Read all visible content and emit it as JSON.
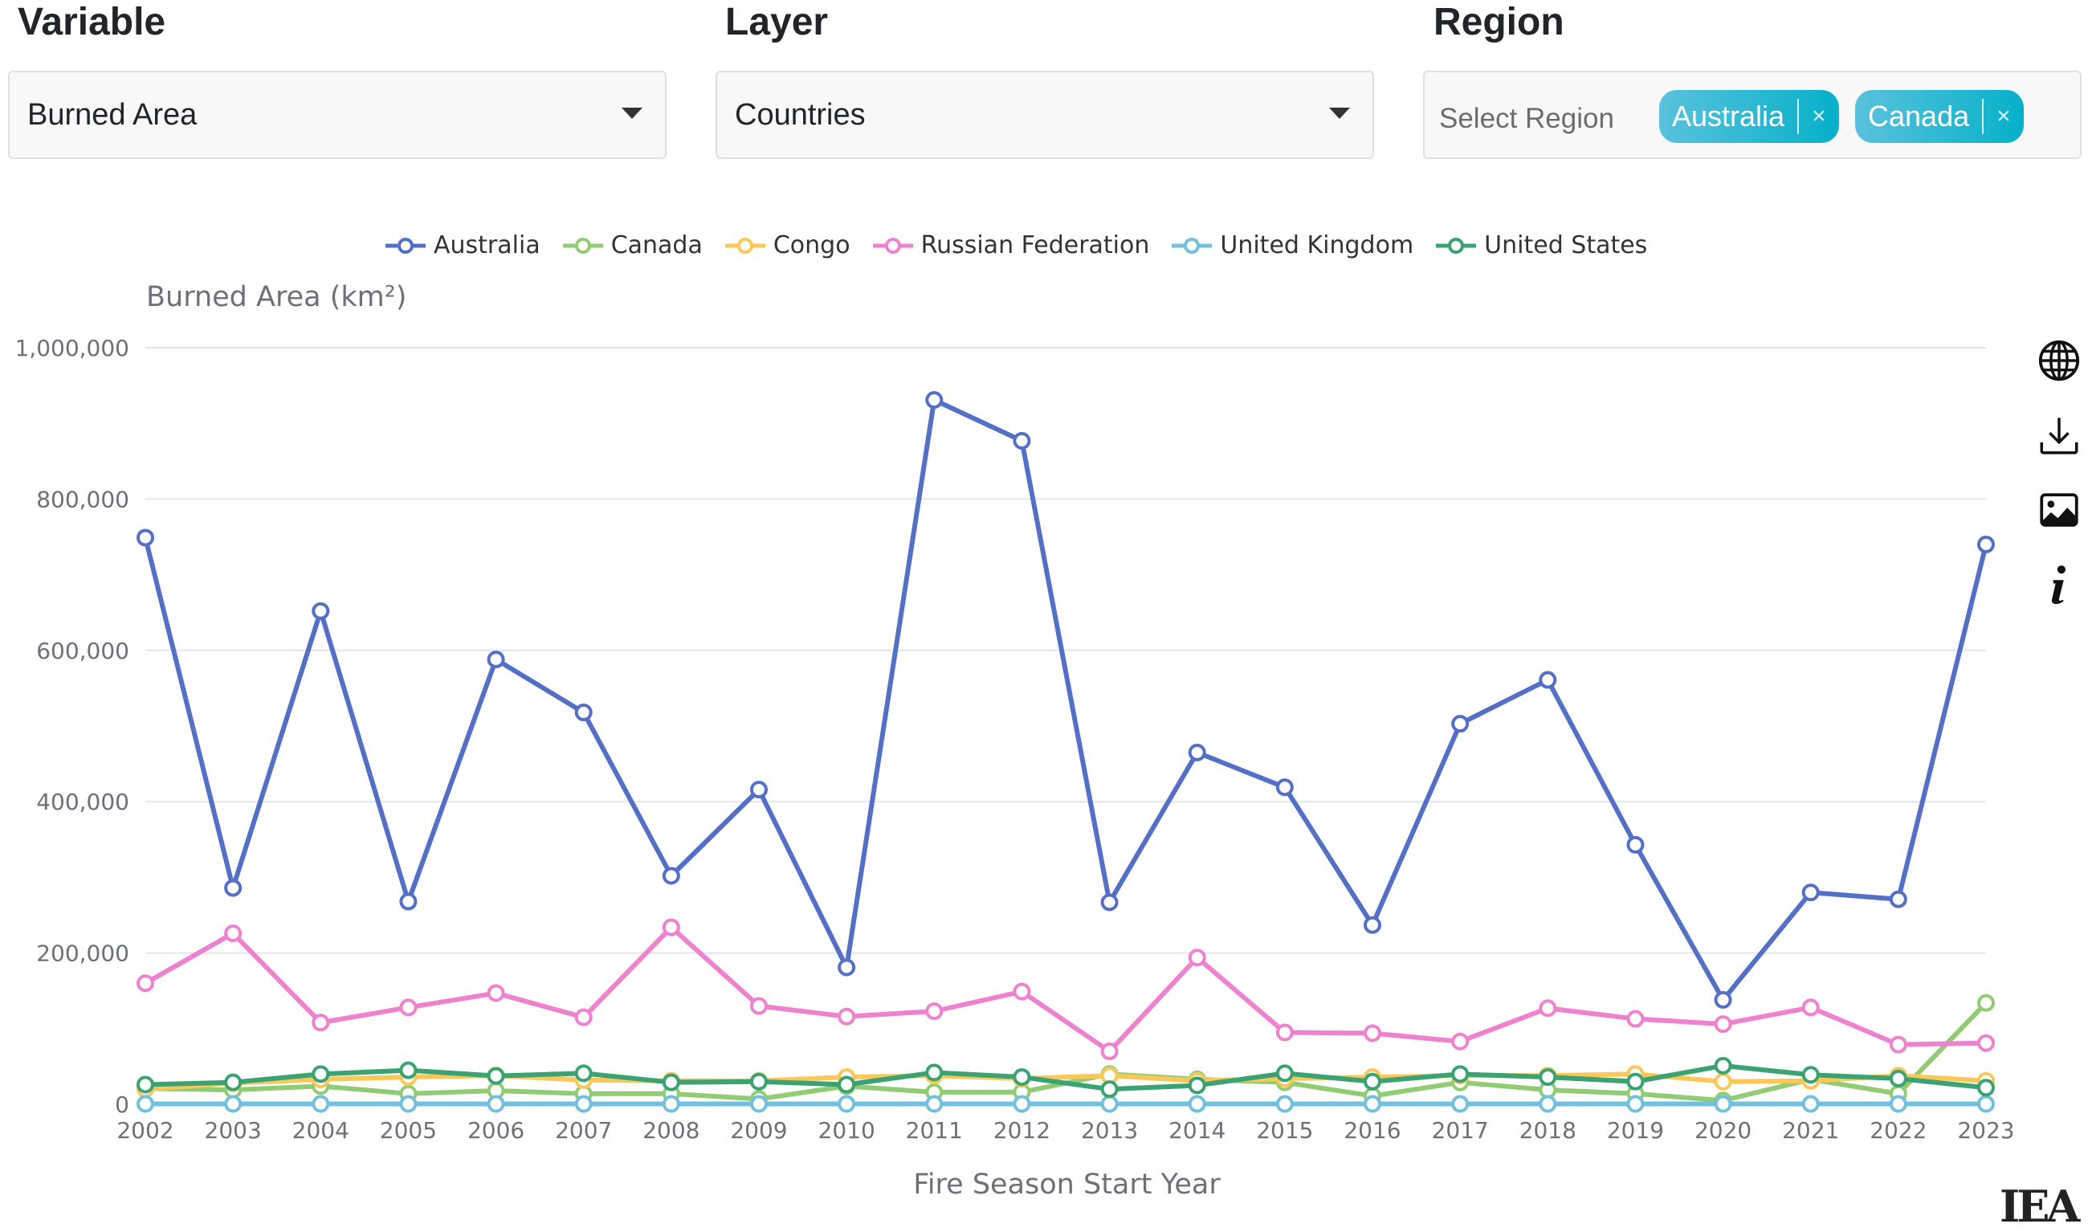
{
  "controls": {
    "variable": {
      "label": "Variable",
      "value": "Burned Area"
    },
    "layer": {
      "label": "Layer",
      "value": "Countries"
    },
    "region": {
      "label": "Region",
      "placeholder": "Select Region",
      "chips": [
        "Australia",
        "Canada"
      ],
      "chip_remove": "×"
    }
  },
  "toolbar": {
    "icons": [
      "globe-icon",
      "download-icon",
      "image-icon",
      "info-icon"
    ]
  },
  "logo_text": "IEA",
  "chart_data": {
    "type": "line",
    "title": "",
    "xlabel": "Fire Season Start Year",
    "ylabel": "Burned Area (km²)",
    "ylim": [
      0,
      1000000
    ],
    "yticks": [
      0,
      200000,
      400000,
      600000,
      800000,
      1000000
    ],
    "ytick_labels": [
      "0",
      "200,000",
      "400,000",
      "600,000",
      "800,000",
      "1,000,000"
    ],
    "grid": true,
    "legend_position": "top-center",
    "x": [
      "2002",
      "2003",
      "2004",
      "2005",
      "2006",
      "2007",
      "2008",
      "2009",
      "2010",
      "2011",
      "2012",
      "2013",
      "2014",
      "2015",
      "2016",
      "2017",
      "2018",
      "2019",
      "2020",
      "2021",
      "2022",
      "2023"
    ],
    "series": [
      {
        "name": "Australia",
        "color": "#5470c6",
        "values": [
          749000,
          286000,
          652000,
          268000,
          588000,
          518000,
          302000,
          416000,
          181000,
          931000,
          877000,
          267000,
          465000,
          419000,
          237000,
          503000,
          561000,
          343000,
          138000,
          280000,
          271000,
          740000
        ]
      },
      {
        "name": "Canada",
        "color": "#91cc75",
        "values": [
          21000,
          19000,
          24000,
          14000,
          18000,
          14000,
          14000,
          7000,
          24000,
          16000,
          16000,
          40000,
          33000,
          29000,
          11000,
          29000,
          19000,
          14000,
          5000,
          33000,
          14000,
          134000
        ]
      },
      {
        "name": "Congo",
        "color": "#fac858",
        "values": [
          20000,
          28000,
          33000,
          36000,
          38000,
          32000,
          31000,
          31000,
          36000,
          38000,
          34000,
          38000,
          31000,
          34000,
          36000,
          38000,
          38000,
          40000,
          30000,
          31000,
          38000,
          31000
        ]
      },
      {
        "name": "Russian Federation",
        "color": "#ee82cf",
        "values": [
          160000,
          226000,
          108000,
          128000,
          147000,
          115000,
          234000,
          130000,
          116000,
          123000,
          149000,
          70000,
          194000,
          95000,
          94000,
          83000,
          127000,
          113000,
          106000,
          128000,
          79000,
          81000
        ]
      },
      {
        "name": "United Kingdom",
        "color": "#73c0de",
        "values": [
          500,
          500,
          500,
          500,
          500,
          500,
          500,
          500,
          500,
          500,
          500,
          500,
          500,
          500,
          500,
          500,
          500,
          500,
          500,
          500,
          500,
          500
        ]
      },
      {
        "name": "United States",
        "color": "#3ba272",
        "values": [
          26000,
          29000,
          40000,
          45000,
          37500,
          41000,
          29000,
          30000,
          26000,
          42000,
          36000,
          20000,
          25000,
          41000,
          30000,
          40000,
          36000,
          30000,
          51000,
          39000,
          34000,
          22000
        ]
      }
    ]
  }
}
